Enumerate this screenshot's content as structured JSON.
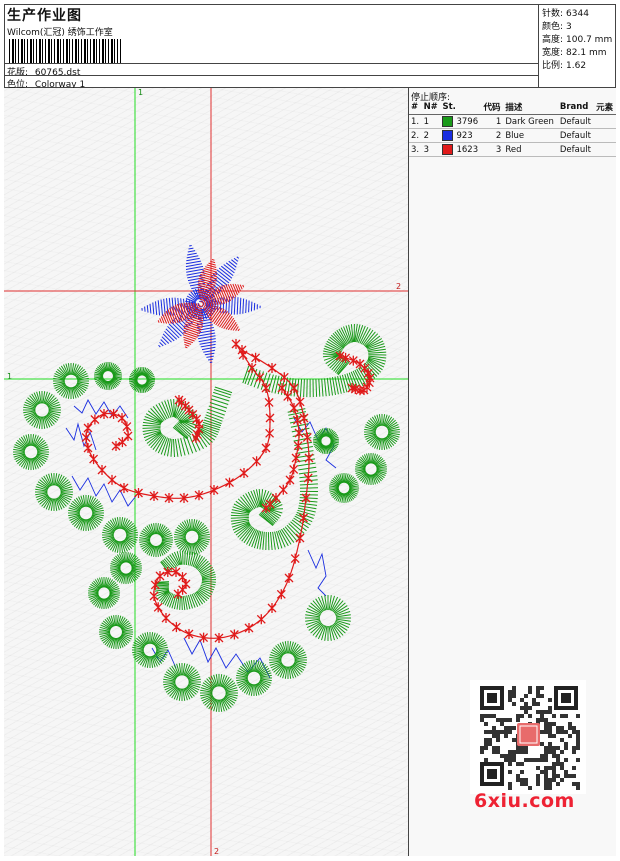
{
  "header": {
    "title": "生产作业图",
    "studio": "Wilcom(汇冠) 绣饰工作室",
    "design_label": "花版:",
    "design_value": "60765.dst",
    "colorway_label": "色位:",
    "colorway_value": "Colorway 1"
  },
  "stats": {
    "stitches_label": "针数:",
    "stitches_value": "6344",
    "colors_label": "颜色:",
    "colors_value": "3",
    "height_label": "高度:",
    "height_value": "100.7 mm",
    "width_label": "宽度:",
    "width_value": "82.1 mm",
    "scale_label": "比例:",
    "scale_value": "1.62"
  },
  "stop_sequence": {
    "title": "停止顺序:",
    "headers": [
      "#",
      "N#",
      "St.",
      "代码",
      "描述",
      "Brand",
      "元素"
    ],
    "rows": [
      {
        "idx": "1.",
        "n": "1",
        "color": "#1a9a1a",
        "st": "3796",
        "code": "1",
        "desc": "Dark Green",
        "brand": "Default"
      },
      {
        "idx": "2.",
        "n": "2",
        "color": "#1a2ee0",
        "st": "923",
        "code": "2",
        "desc": "Blue",
        "brand": "Default"
      },
      {
        "idx": "3.",
        "n": "3",
        "color": "#e01a1a",
        "st": "1623",
        "code": "3",
        "desc": "Red",
        "brand": "Default"
      }
    ]
  },
  "guides": {
    "v1": "1",
    "h2": "2",
    "h1": "1",
    "v2": "2",
    "green": "#22dd22",
    "red": "#e03030"
  },
  "watermark": "6xiu.com",
  "thread_colors": {
    "green": "#1a9a1a",
    "blue": "#1a2ee0",
    "red": "#e01a1a"
  }
}
